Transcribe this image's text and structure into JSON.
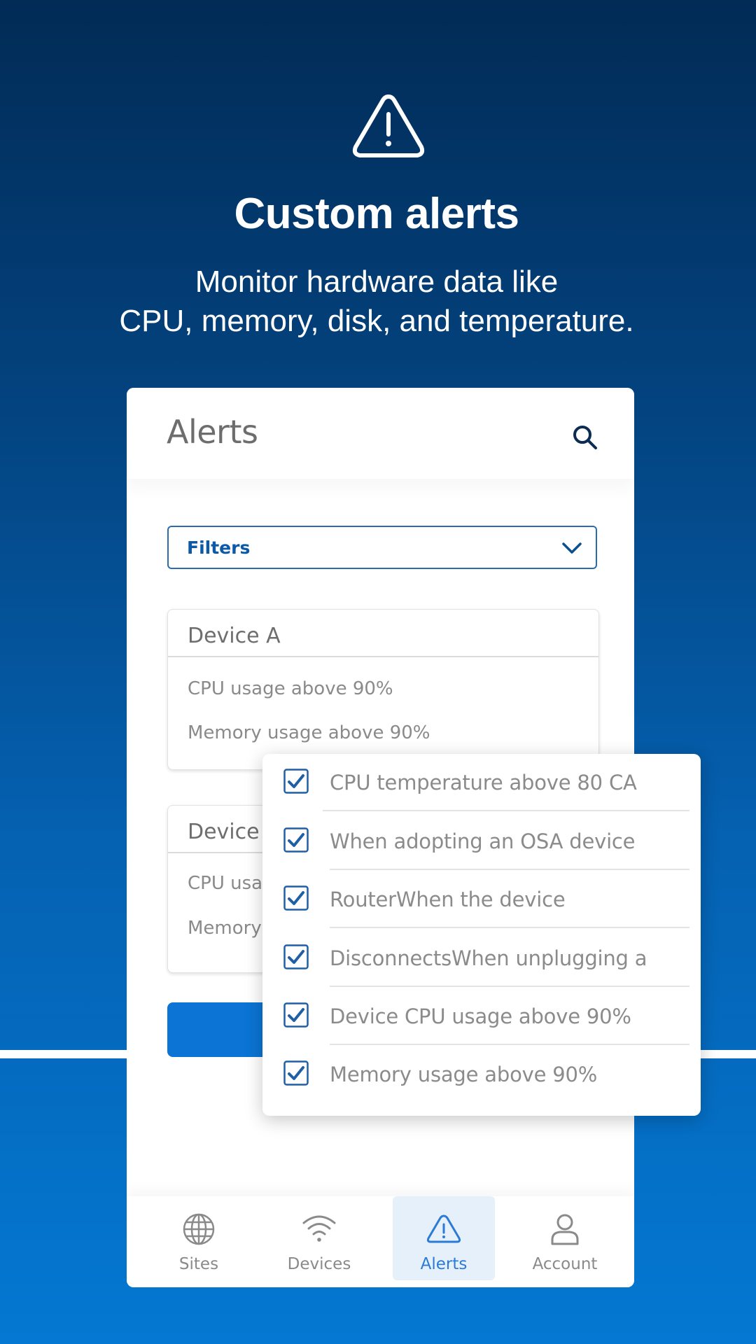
{
  "hero": {
    "icon": "warning-triangle-icon",
    "title": "Custom alerts",
    "subtitle_line1": "Monitor hardware data like",
    "subtitle_line2": "CPU, memory, disk, and temperature."
  },
  "app": {
    "header": {
      "title": "Alerts",
      "search_icon": "search-icon"
    },
    "filters": {
      "label": "Filters",
      "icon": "chevron-down-icon"
    },
    "cards": [
      {
        "title": "Device A",
        "lines": [
          "CPU usage above 90%",
          "Memory usage above 90%"
        ]
      },
      {
        "title": "Device",
        "lines": [
          "CPU usag",
          "Memory"
        ]
      }
    ],
    "bottom_nav": [
      {
        "label": "Sites",
        "icon": "globe-icon",
        "active": false
      },
      {
        "label": "Devices",
        "icon": "wifi-icon",
        "active": false
      },
      {
        "label": "Alerts",
        "icon": "warning-triangle-icon",
        "active": true
      },
      {
        "label": "Account",
        "icon": "user-icon",
        "active": false
      }
    ]
  },
  "popover": {
    "items": [
      {
        "label": "CPU temperature above 80 CA",
        "checked": true
      },
      {
        "label": "When adopting an OSA device",
        "checked": true
      },
      {
        "label": "RouterWhen the device",
        "checked": true
      },
      {
        "label": "DisconnectsWhen unplugging a",
        "checked": true
      },
      {
        "label": "Device CPU usage above 90%",
        "checked": true
      },
      {
        "label": "Memory usage above 90%",
        "checked": true
      }
    ]
  },
  "colors": {
    "bg_top": "#022b56",
    "bg_bottom": "#0478d2",
    "accent": "#0b74d4",
    "checkbox": "#1f5fa6",
    "nav_active_bg": "#e6f0fb",
    "nav_active_text": "#2b7bd6"
  }
}
